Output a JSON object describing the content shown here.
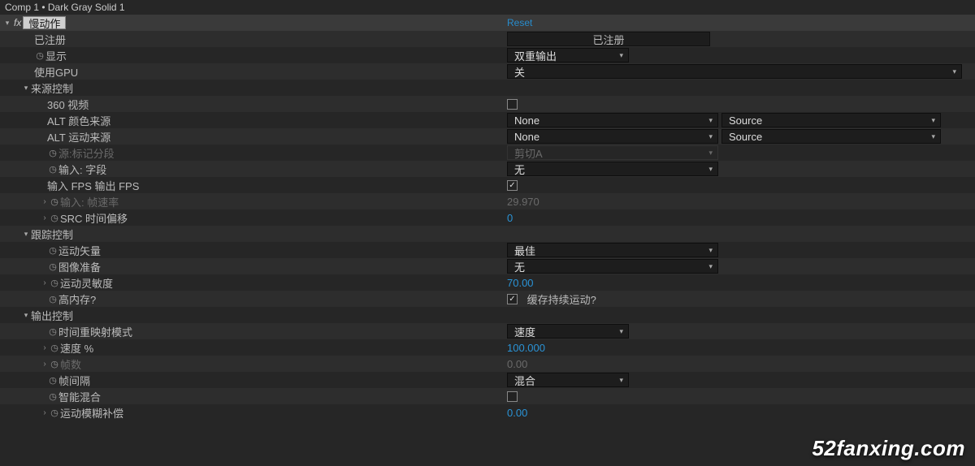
{
  "tab_title": "Comp 1 • Dark Gray Solid 1",
  "effect": {
    "name": "慢动作",
    "reset": "Reset"
  },
  "rows": {
    "registered": {
      "label": "已注册",
      "value": "已注册"
    },
    "display": {
      "label": "显示",
      "value": "双重输出"
    },
    "gpu": {
      "label": "使用GPU",
      "value": "关"
    },
    "source_ctrl": {
      "label": "来源控制"
    },
    "video360": {
      "label": "360 视频",
      "checked": false
    },
    "alt_color": {
      "label": "ALT 颜色来源",
      "left": "None",
      "right": "Source"
    },
    "alt_motion": {
      "label": "ALT 运动来源",
      "left": "None",
      "right": "Source"
    },
    "src_mark": {
      "label": "源:标记分段",
      "value": "剪切A"
    },
    "input_field": {
      "label": "输入: 字段",
      "value": "无"
    },
    "fps_io": {
      "label": "输入 FPS  输出 FPS",
      "checked": true
    },
    "input_fps": {
      "label": "输入: 帧速率",
      "value": "29.970"
    },
    "src_offset": {
      "label": "SRC 时间偏移",
      "value": "0"
    },
    "track_ctrl": {
      "label": "跟踪控制"
    },
    "motion_vec": {
      "label": "运动矢量",
      "value": "最佳"
    },
    "image_prep": {
      "label": "图像准备",
      "value": "无"
    },
    "sensitivity": {
      "label": "运动灵敏度",
      "value": "70.00"
    },
    "hi_mem": {
      "label": "高内存?",
      "checked": true,
      "caption": "缓存持续运动?"
    },
    "output_ctrl": {
      "label": "输出控制"
    },
    "time_remap": {
      "label": "时间重映射模式",
      "value": "速度"
    },
    "speed": {
      "label": "速度 %",
      "value": "100.000"
    },
    "frames": {
      "label": "帧数",
      "value": "0.00"
    },
    "frame_gap": {
      "label": "帧间隔",
      "value": "混合"
    },
    "smart_blend": {
      "label": "智能混合",
      "checked": false
    },
    "mb_comp": {
      "label": "运动模糊补偿",
      "value": "0.00"
    }
  },
  "watermark": "52fanxing.com"
}
